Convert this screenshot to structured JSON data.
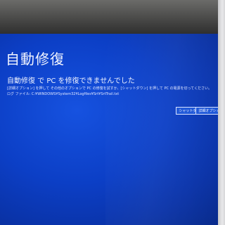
{
  "recovery": {
    "title": "自動修復",
    "subtitle": "自動修復 で PC を修復できませんでした",
    "description": "[詳細オプション] を押して その他のオプションで PC の修復を試すか、[シャットダウン] を押して PC の電源を切ってください。",
    "log_file": "ログ ファイル: C:¥WINDOWS¥System32¥Logfiles¥Srt¥SrtTrail.txt",
    "buttons": {
      "shutdown": "シャットダウン",
      "advanced": "詳細オプション"
    }
  },
  "colors": {
    "background": "#0c3fc6",
    "text": "#f2f5ff"
  }
}
